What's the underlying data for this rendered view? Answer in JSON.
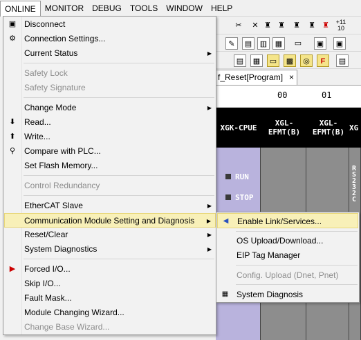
{
  "menubar": {
    "items": [
      "ONLINE",
      "MONITOR",
      "DEBUG",
      "TOOLS",
      "WINDOW",
      "HELP"
    ]
  },
  "background": {
    "program_tab": "f_Reset[Program]",
    "program_tab_close": "×",
    "slot_numbers": [
      "00",
      "01"
    ],
    "rack_headers": [
      "XGK-CPUE",
      "XGL-\nEFMT(B)",
      "XGL-\nEFMT(B)",
      "XG"
    ],
    "cpu_leds": [
      "RUN",
      "STOP"
    ],
    "rs_label": "RS232C",
    "toolbar_text": [
      "+11",
      "10"
    ]
  },
  "online_menu": {
    "items": [
      {
        "label": "Disconnect",
        "icon": "disconnect-icon",
        "enabled": true
      },
      {
        "label": "Connection Settings...",
        "icon": "connection-settings-icon",
        "enabled": true
      },
      {
        "label": "Current Status",
        "enabled": true,
        "submenu": true
      },
      {
        "label": "Safety Lock",
        "enabled": false
      },
      {
        "label": "Safety Signature",
        "enabled": false
      },
      {
        "label": "Change Mode",
        "enabled": true,
        "submenu": true
      },
      {
        "label": "Read...",
        "icon": "read-icon",
        "enabled": true
      },
      {
        "label": "Write...",
        "icon": "write-icon",
        "enabled": true
      },
      {
        "label": "Compare with PLC...",
        "icon": "compare-icon",
        "enabled": true
      },
      {
        "label": "Set Flash Memory...",
        "enabled": true
      },
      {
        "label": "Control Redundancy",
        "enabled": false
      },
      {
        "label": "EtherCAT Slave",
        "enabled": true,
        "submenu": true
      },
      {
        "label": "Communication Module Setting and Diagnosis",
        "enabled": true,
        "submenu": true,
        "highlighted": true
      },
      {
        "label": "Reset/Clear",
        "enabled": true,
        "submenu": true
      },
      {
        "label": "System Diagnostics",
        "enabled": true,
        "submenu": true
      },
      {
        "label": "Forced I/O...",
        "icon": "forced-io-icon",
        "enabled": true
      },
      {
        "label": "Skip I/O...",
        "enabled": true
      },
      {
        "label": "Fault Mask...",
        "enabled": true
      },
      {
        "label": "Module Changing Wizard...",
        "enabled": true
      },
      {
        "label": "Change Base Wizard...",
        "enabled": false
      }
    ]
  },
  "comm_submenu": {
    "items": [
      {
        "label": "Enable Link/Services...",
        "icon": "enable-link-icon",
        "enabled": true,
        "highlighted": true
      },
      {
        "label": "OS Upload/Download...",
        "enabled": true
      },
      {
        "label": "EIP Tag Manager",
        "enabled": true
      },
      {
        "label": "Config. Upload (Dnet, Pnet)",
        "enabled": false
      },
      {
        "label": "System Diagnosis",
        "icon": "system-diagnosis-icon",
        "enabled": true
      }
    ]
  },
  "colors": {
    "highlight": "#f8f0b8",
    "cpu_slot": "#b9b3dd",
    "io_slot": "#8d8d8d",
    "disabled_text": "#8d8d8d"
  }
}
